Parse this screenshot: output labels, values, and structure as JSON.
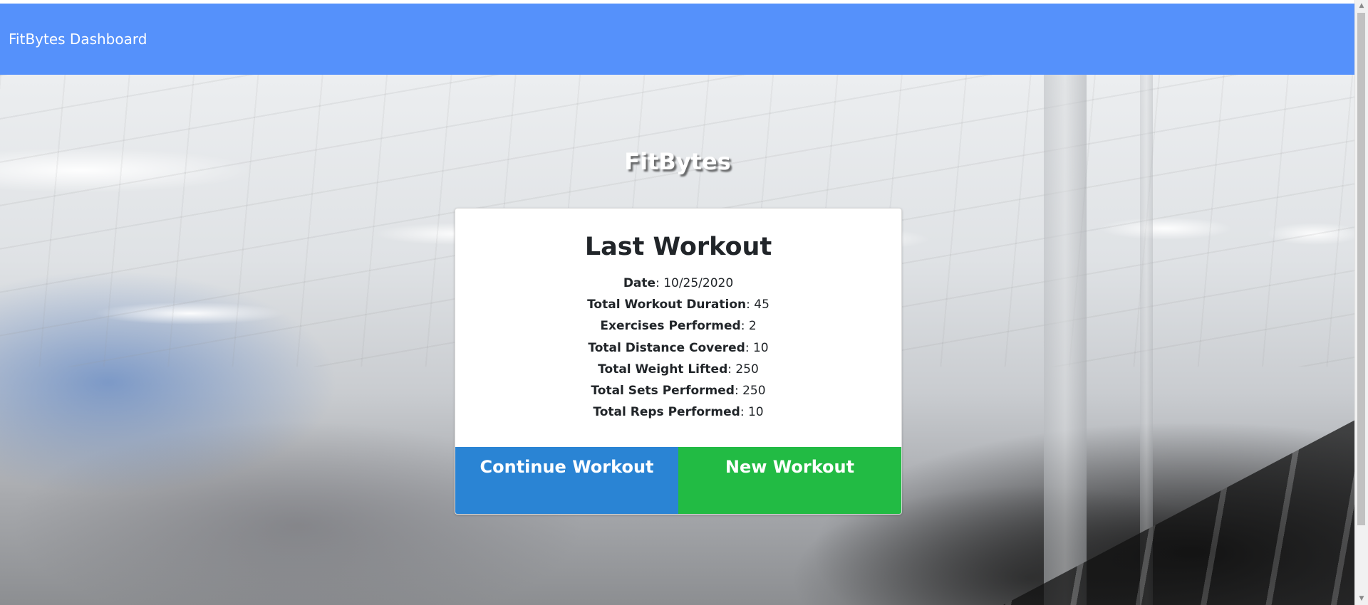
{
  "navbar": {
    "brand": "FitBytes Dashboard",
    "background_color": "#5591fb"
  },
  "hero": {
    "title": "FitBytes",
    "background_image": "blurred-gym-photo"
  },
  "last_workout": {
    "heading": "Last Workout",
    "stats": [
      {
        "label": "Date",
        "value": ": 10/25/2020"
      },
      {
        "label": "Total Workout Duration",
        "value": ": 45"
      },
      {
        "label": "Exercises Performed",
        "value": ": 2"
      },
      {
        "label": "Total Distance Covered",
        "value": ": 10"
      },
      {
        "label": "Total Weight Lifted",
        "value": ": 250"
      },
      {
        "label": "Total Sets Performed",
        "value": ": 250"
      },
      {
        "label": "Total Reps Performed",
        "value": ": 10"
      }
    ],
    "buttons": {
      "continue_label": "Continue Workout",
      "continue_color": "#2a84d4",
      "new_label": "New Workout",
      "new_color": "#22bb44"
    }
  },
  "scrollbar": {
    "up_icon": "triangle-up-icon",
    "down_icon": "triangle-down-icon"
  }
}
